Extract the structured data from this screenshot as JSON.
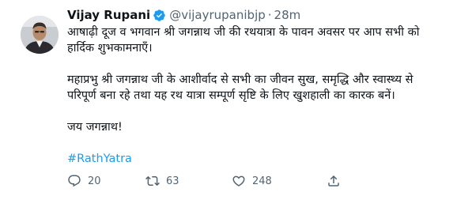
{
  "author": {
    "name": "Vijay Rupani",
    "handle": "@vijayrupanibjp",
    "separator": "·",
    "time": "28m"
  },
  "body": {
    "paragraph1_line1": "आषाढ़ी दूज व भगवान श्री जगन्नाथ जी की रथयात्रा के पावन अवसर पर आप सभी को",
    "paragraph1_line2": "हार्दिक शुभकामनाएँ।",
    "paragraph2_line1": "महाप्रभु श्री जगन्नाथ जी के आशीर्वाद से सभी का जीवन सुख, समृद्धि और स्वास्थ्य से",
    "paragraph2_line2": "परिपूर्ण बना रहे तथा यह रथ यात्रा सम्पूर्ण सृष्टि के लिए खुशहाली का कारक बनें।",
    "paragraph3": "जय जगन्नाथ!",
    "hashtag": "#RathYatra"
  },
  "actions": {
    "replies": "20",
    "retweets": "63",
    "likes": "248"
  },
  "colors": {
    "link": "#1d9bf0",
    "secondary_text": "#536471",
    "primary_text": "#0f1419",
    "verified": "#1d9bf0"
  },
  "icons": {
    "verified": "verified-badge-icon",
    "reply": "reply-icon",
    "retweet": "retweet-icon",
    "like": "heart-icon",
    "share": "share-icon"
  }
}
